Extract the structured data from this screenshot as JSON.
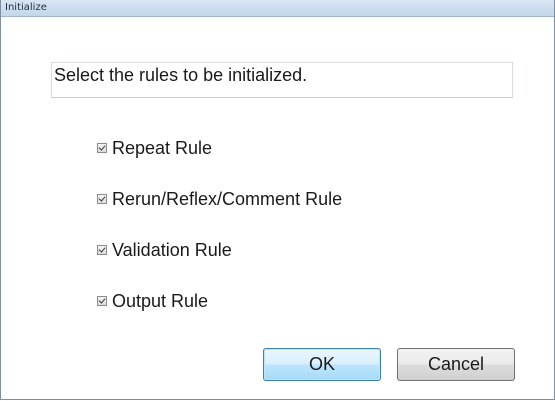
{
  "window": {
    "title": "Initialize"
  },
  "prompt": "Select the rules to be initialized.",
  "rules": [
    {
      "label": "Repeat Rule",
      "checked": true
    },
    {
      "label": "Rerun/Reflex/Comment Rule",
      "checked": true
    },
    {
      "label": "Validation Rule",
      "checked": true
    },
    {
      "label": "Output Rule",
      "checked": true
    }
  ],
  "buttons": {
    "ok_label": "OK",
    "cancel_label": "Cancel"
  },
  "colors": {
    "ok_accent": "#3c7fb1",
    "titlebar": "#c3d6ec"
  }
}
